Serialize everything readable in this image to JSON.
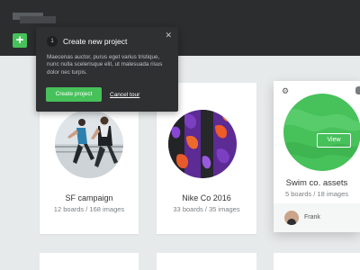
{
  "toolbar": {
    "add_label": "+"
  },
  "tour": {
    "step": "1",
    "title": "Create new project",
    "close_label": "✕",
    "body": "Maecenas auctor, purus eget varius tristique, nunc nulla scelerisque elit, ut malesuada risus dolor nec turpis.",
    "primary_label": "Create project",
    "cancel_label": "Cancel tour"
  },
  "projects": [
    {
      "title": "SF campaign",
      "meta": "12 boards / 168 images"
    },
    {
      "title": "Nike Co 2016",
      "meta": "33 boards / 35 images"
    },
    {
      "title": "Swim co. assets",
      "meta": "5 boards / 18 images",
      "view_label": "View",
      "user_name": "Frank",
      "accent": "#47c15a"
    }
  ]
}
